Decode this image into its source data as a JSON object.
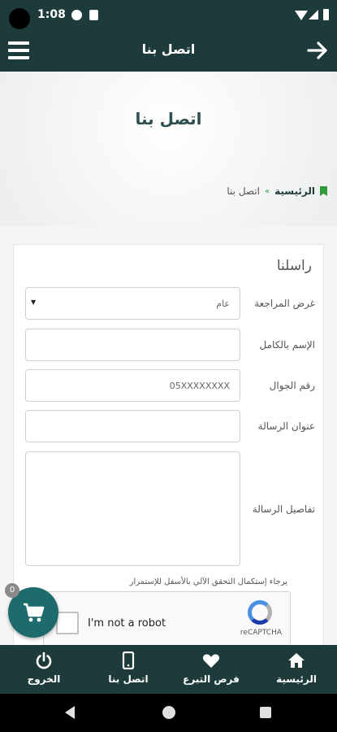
{
  "status_bar": {
    "time": "1:08"
  },
  "app_bar": {
    "title": "اتصل بنا"
  },
  "hero": {
    "title": "اتصل بنا"
  },
  "breadcrumb": {
    "home": "الرئيسية",
    "separator": "»",
    "current": "اتصل بنا"
  },
  "form": {
    "title": "راسلنا",
    "fields": [
      {
        "label": "غرض المراجعة",
        "value": "عام",
        "type": "select"
      },
      {
        "label": "الإسم بالكامل",
        "value": "",
        "type": "text"
      },
      {
        "label": "رقم الجوال",
        "value": "05XXXXXXXX",
        "type": "text"
      },
      {
        "label": "عنوان الرسالة",
        "value": "",
        "type": "text"
      },
      {
        "label": "تفاصيل الرسالة",
        "value": "",
        "type": "textarea"
      }
    ],
    "captcha_note": "يرجاء إستكمال التحقق الآلي بالأسفل للإستمرار",
    "captcha": {
      "checkbox_label": "I'm not a robot",
      "brand": "reCAPTCHA"
    }
  },
  "cart": {
    "count": "0"
  },
  "bottom_nav": [
    {
      "label": "الرئيسية",
      "icon": "home-icon"
    },
    {
      "label": "فرص التبرع",
      "icon": "heart-icon"
    },
    {
      "label": "اتصل بنا",
      "icon": "phone-icon"
    },
    {
      "label": "الخروج",
      "icon": "power-icon"
    }
  ],
  "colors": {
    "primary": "#1d3b3a",
    "accent": "#2e9c3a",
    "fab": "#1d6b6c"
  }
}
